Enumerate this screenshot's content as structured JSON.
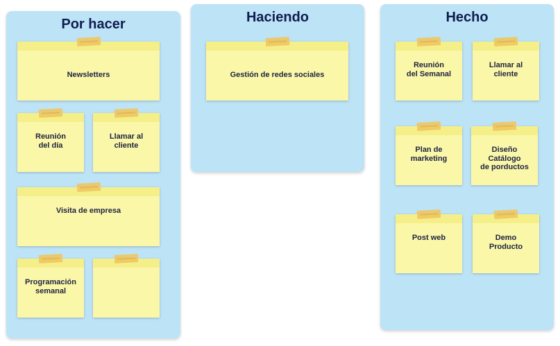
{
  "board": {
    "columns": [
      {
        "title": "Por hacer",
        "notes": [
          "Newsletters",
          "Reunión\ndel día",
          "Llamar al\ncliente",
          "Visita de empresa",
          "Programación\nsemanal",
          ""
        ]
      },
      {
        "title": "Haciendo",
        "notes": [
          "Gestión de redes sociales"
        ]
      },
      {
        "title": "Hecho",
        "notes": [
          "Reunión\ndel Semanal",
          "Llamar al\ncliente",
          "Plan de\nmarketing",
          "Diseño\nCatálogo\nde porductos",
          "Post web",
          "Demo\nProducto"
        ]
      }
    ]
  },
  "colors": {
    "column_background": "#bde3f6",
    "note_background": "#fbf7a8",
    "tape": "#f0c760",
    "title_text": "#0f1d50"
  }
}
